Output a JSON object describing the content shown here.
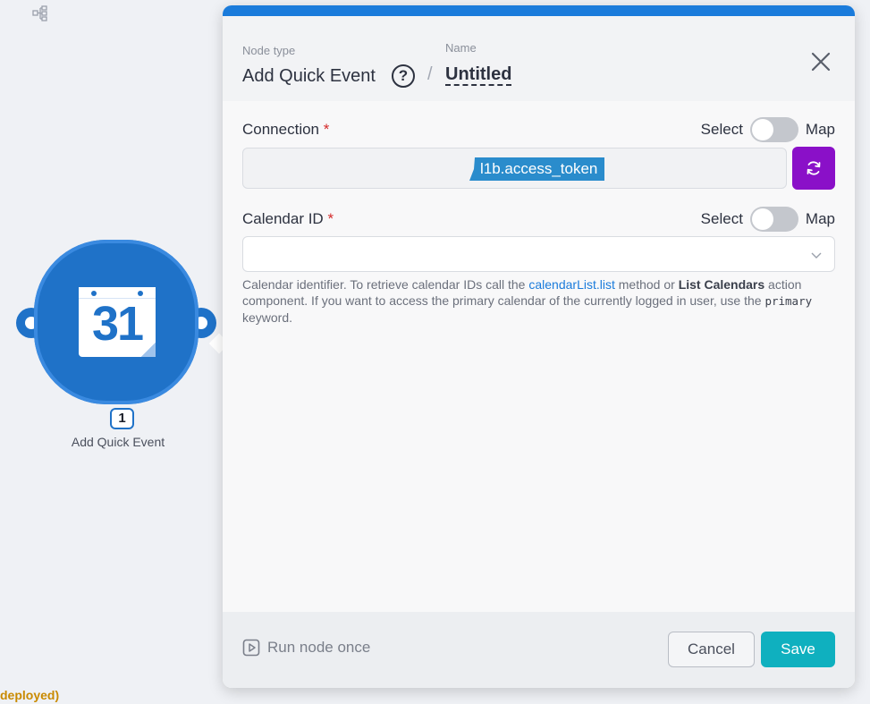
{
  "canvas": {
    "node": {
      "icon_text": "31",
      "badge": "1",
      "label": "Add Quick Event"
    },
    "status_text": "deployed)"
  },
  "panel": {
    "header": {
      "node_type_label": "Node type",
      "node_type_value": "Add Quick Event",
      "help_icon": "?",
      "separator": "/",
      "name_label": "Name",
      "name_value": "Untitled"
    },
    "fields": {
      "connection": {
        "label": "Connection",
        "required_mark": "*",
        "toggle_left": "Select",
        "toggle_right": "Map",
        "token_text": "l1b.access_token"
      },
      "calendar_id": {
        "label": "Calendar ID",
        "required_mark": "*",
        "toggle_left": "Select",
        "toggle_right": "Map",
        "value": "",
        "help": {
          "p1": "Calendar identifier. To retrieve calendar IDs call the ",
          "link": "calendarList.list",
          "p2": " method or ",
          "bold": "List Calendars",
          "p3": " action component. If you want to access the primary calendar of the currently logged in user, use the ",
          "code": "primary",
          "p4": " keyword."
        }
      }
    },
    "footer": {
      "run_once_label": "Run node once",
      "cancel_label": "Cancel",
      "save_label": "Save"
    }
  },
  "colors": {
    "accent_blue": "#1a7bdb",
    "node_blue": "#1f72c8",
    "refresh_purple": "#8a10c8",
    "save_teal": "#0fb0bf",
    "token_blue": "#2a8ccc",
    "required_red": "#d42b2b",
    "deployed_gold": "#c98a00"
  },
  "icons": [
    "tree-icon",
    "calendar-icon",
    "help-icon",
    "close-icon",
    "refresh-icon",
    "chevron-down-icon",
    "play-icon"
  ]
}
